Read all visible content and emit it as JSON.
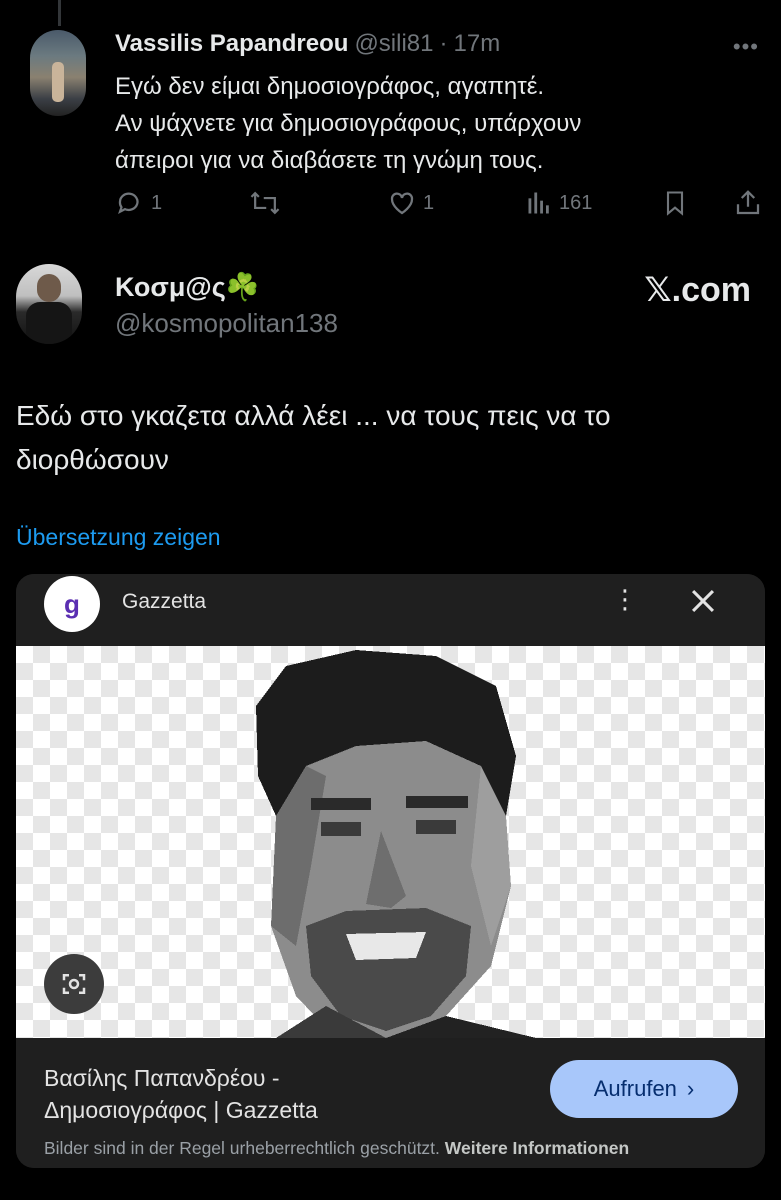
{
  "reply": {
    "name": "Vassilis Papandreou",
    "handle": "@sili81",
    "separator": "·",
    "time": "17m",
    "text_lines": [
      "Εγώ δεν είμαι δημοσιογράφος, αγαπητέ.",
      "Αν ψάχνετε για δημοσιογράφους, υπάρχουν",
      "άπειροι για να διαβάσετε τη γνώμη τους."
    ],
    "actions": {
      "replies": "1",
      "retweets": "",
      "likes": "1",
      "views": "161"
    }
  },
  "quoted": {
    "name": "Κοσμ@ς☘️",
    "handle": "@kosmopolitan138",
    "site": "𝕏.com",
    "text_lines": [
      "Εδώ στο γκαζετα αλλά λέει ... να τους πεις να το",
      "διορθώσουν"
    ],
    "translate_link": "Übersetzung zeigen"
  },
  "lens_card": {
    "source_logo": "g",
    "source_name": "Gazzetta",
    "result_title_lines": [
      "Βασίλης Παπανδρέου -",
      "Δημοσιογράφος | Gazzetta"
    ],
    "open_button": "Aufrufen",
    "open_chevron": "›",
    "copyright_text": "Bilder sind in der Regel urheberrechtlich geschützt.",
    "more_info": "Weitere Informationen"
  },
  "colors": {
    "background": "#000000",
    "text": "#e7e9ea",
    "muted": "#71767b",
    "link": "#1d9bf0",
    "card": "#1f1f1f",
    "button": "#a8c7fa"
  }
}
